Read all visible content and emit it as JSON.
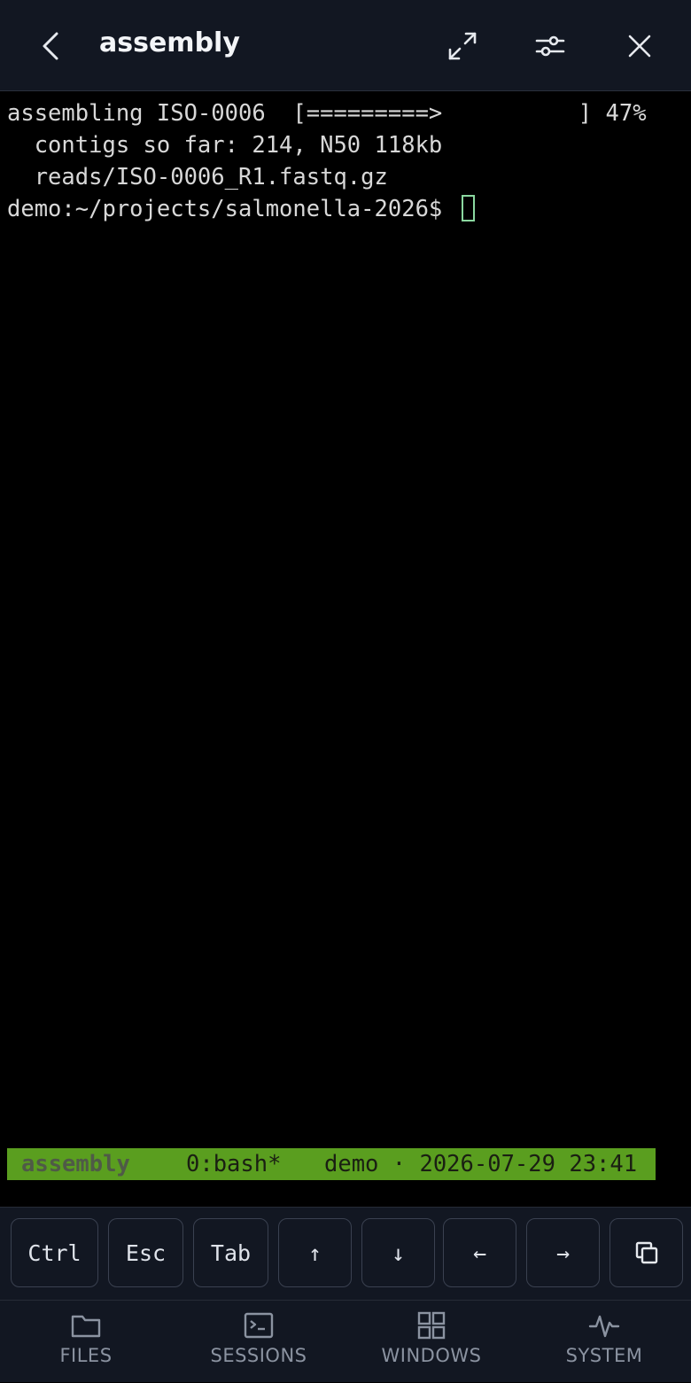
{
  "header": {
    "title": "assembly",
    "icons": [
      "back-icon",
      "expand-icon",
      "settings-sliders-icon",
      "close-icon"
    ]
  },
  "terminal": {
    "lines": [
      "assembling ISO-0006  [=========>          ] 47%",
      "  contigs so far: 214, N50 118kb",
      "  reads/ISO-0006_R1.fastq.gz",
      "demo:~/projects/salmonella-2026$ "
    ],
    "progress_percent": 47
  },
  "statusbar": {
    "session": "assembly",
    "window": "0:bash*",
    "right": "demo · 2026-07-29 23:41",
    "color": "#5a9e1f"
  },
  "keys": {
    "ctrl": "Ctrl",
    "esc": "Esc",
    "tab": "Tab",
    "up": "↑",
    "down": "↓",
    "left": "←",
    "right": "→",
    "copy_icon": "copy-icon"
  },
  "nav": {
    "files": "FILES",
    "sessions": "SESSIONS",
    "windows": "WINDOWS",
    "system": "SYSTEM"
  }
}
